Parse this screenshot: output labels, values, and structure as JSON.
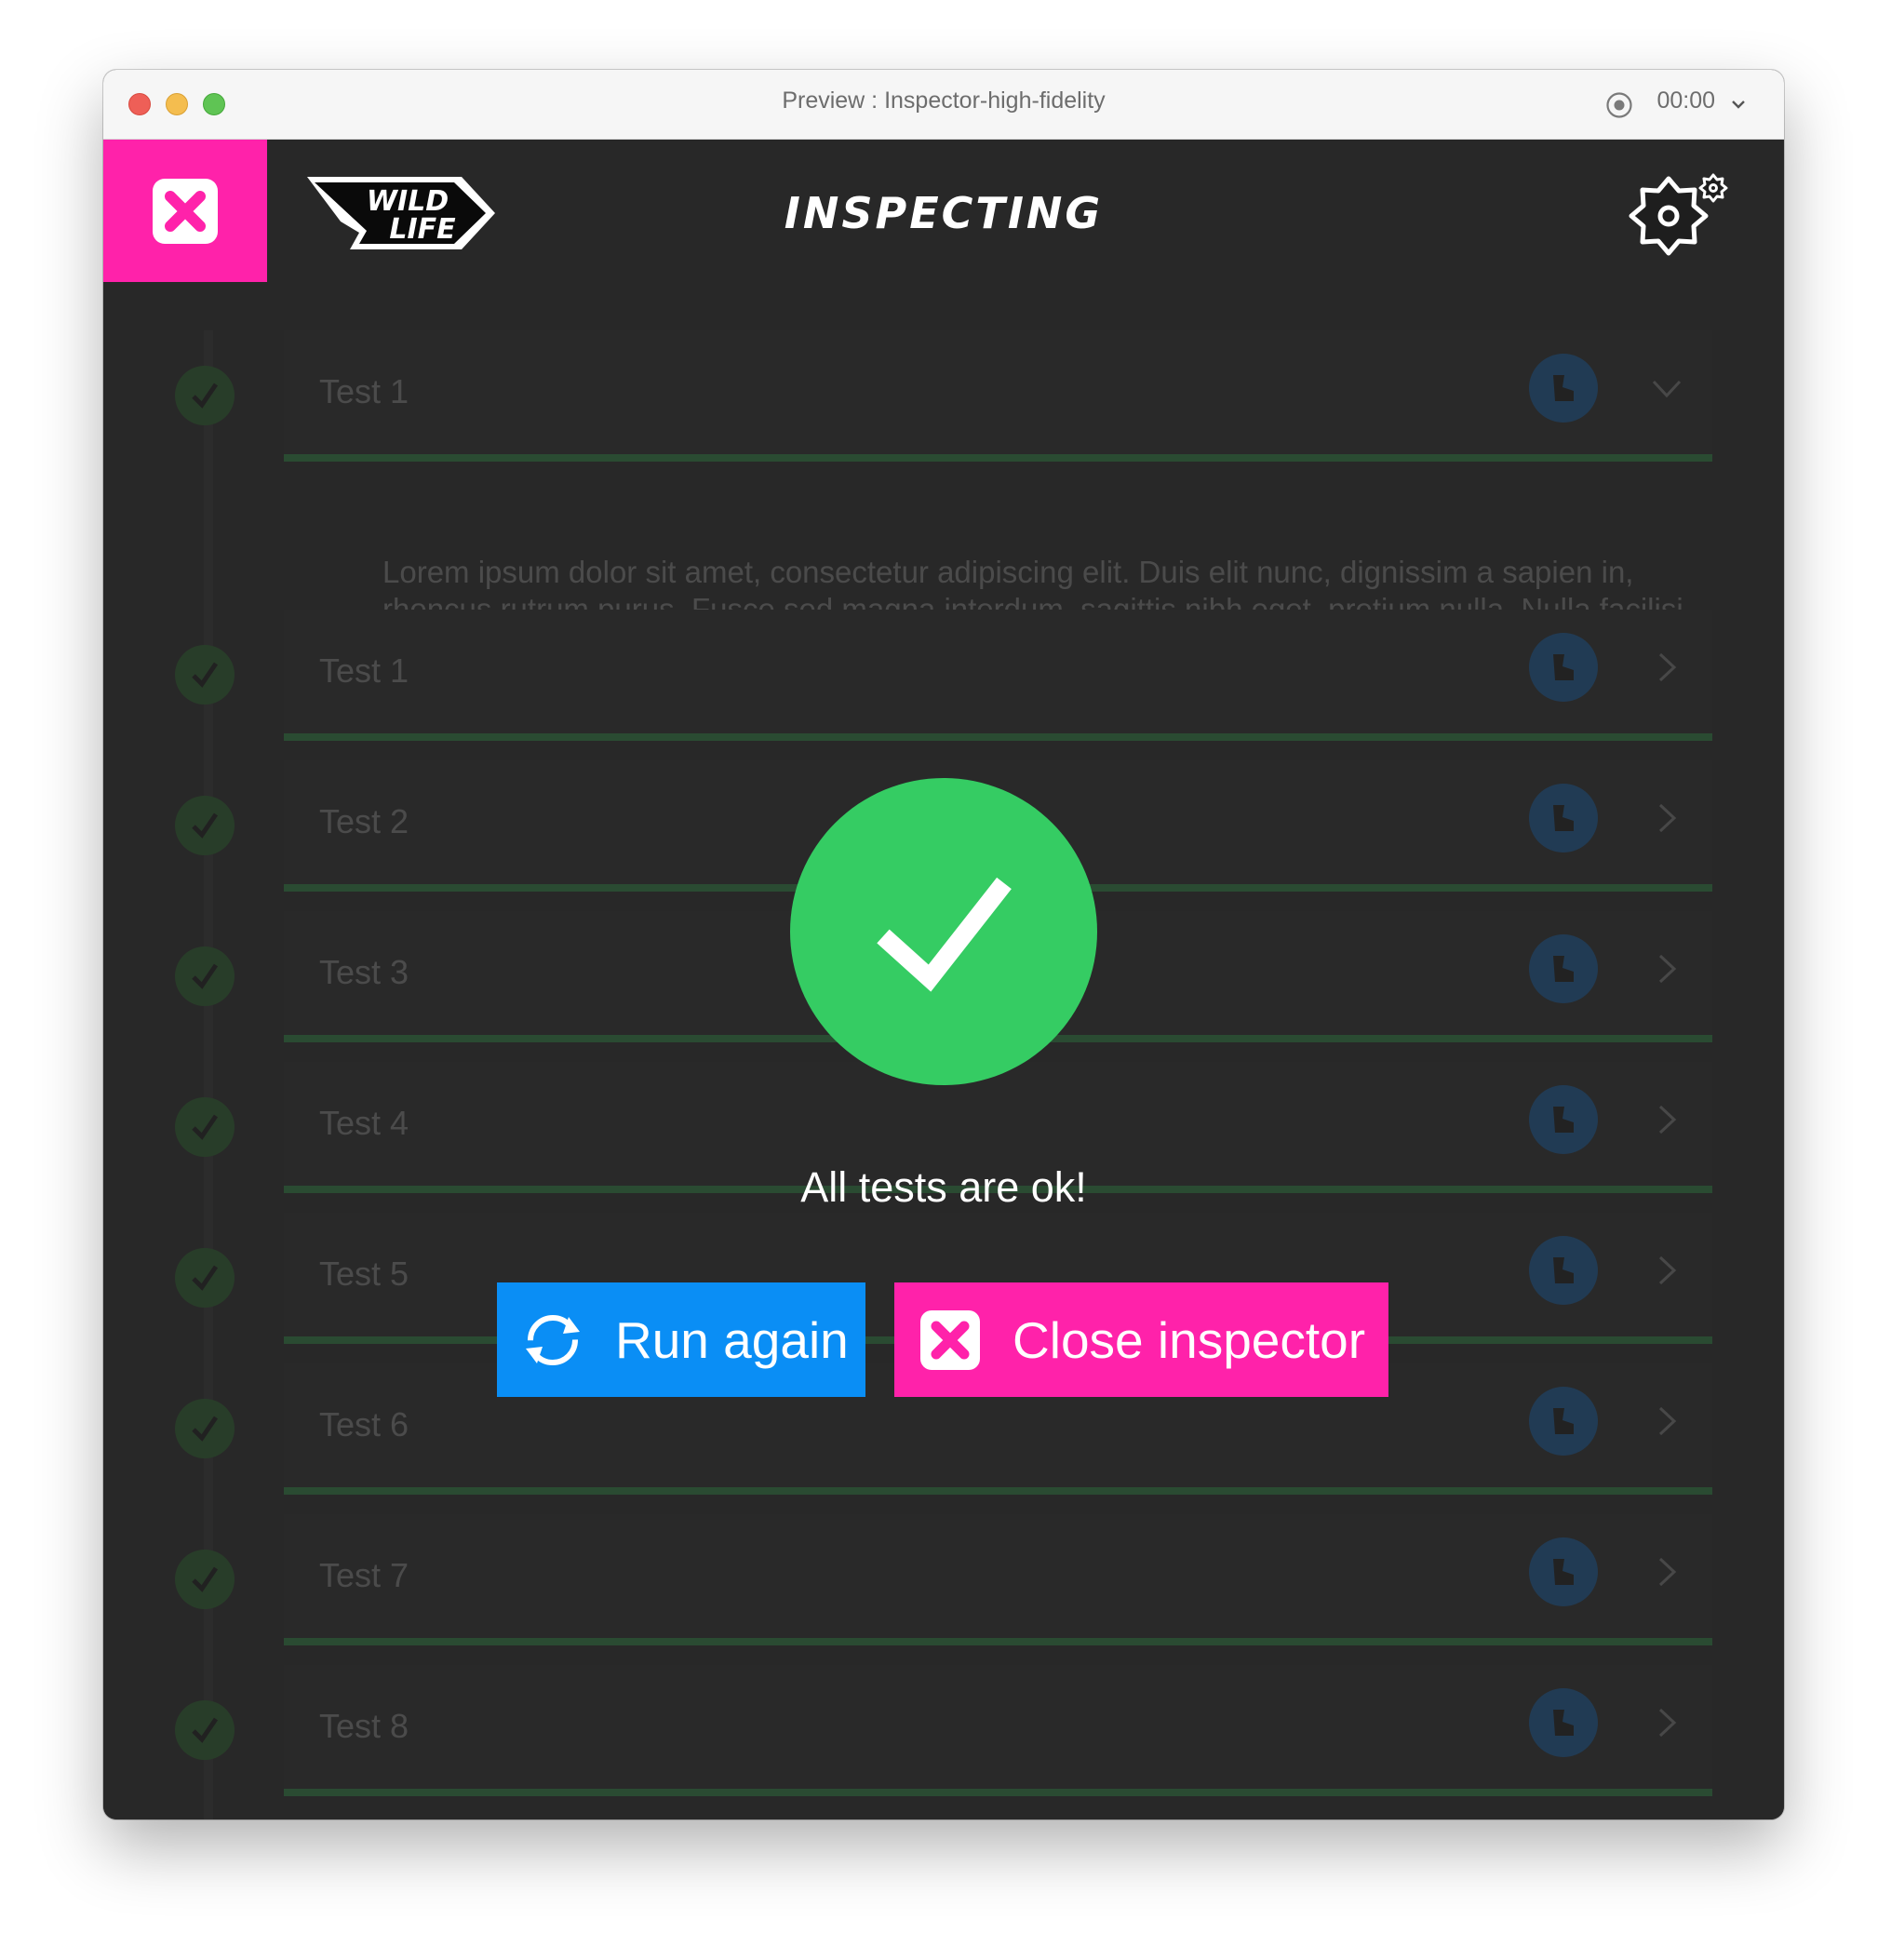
{
  "window": {
    "title": "Preview : Inspector-high-fidelity",
    "recording_time": "00:00"
  },
  "header": {
    "title": "INSPECTING",
    "logo_text": [
      "WILD",
      "LIFE"
    ]
  },
  "tests": [
    {
      "label": "Test 1",
      "status": "passed",
      "expanded": true,
      "description": "Lorem ipsum dolor sit amet, consectetur adipiscing elit. Duis elit nunc, dignissim a sapien in, rhoncus rutrum purus. Fusce sed magna interdum, sagittis nibh eget, pretium nulla. Nulla facilisi. Nunc sed ex sit amet purus sodales dignissim."
    },
    {
      "label": "Test 1",
      "status": "passed",
      "expanded": false
    },
    {
      "label": "Test 2",
      "status": "passed",
      "expanded": false
    },
    {
      "label": "Test 3",
      "status": "passed",
      "expanded": false
    },
    {
      "label": "Test 4",
      "status": "passed",
      "expanded": false
    },
    {
      "label": "Test 5",
      "status": "passed",
      "expanded": false
    },
    {
      "label": "Test 6",
      "status": "passed",
      "expanded": false
    },
    {
      "label": "Test 7",
      "status": "passed",
      "expanded": false
    },
    {
      "label": "Test 8",
      "status": "passed",
      "expanded": false
    }
  ],
  "result": {
    "message": "All tests are ok!",
    "run_again_label": "Run again",
    "close_label": "Close inspector"
  },
  "icons": {
    "close": "close-x-icon",
    "settings": "gear-icon",
    "success": "checkmark-icon",
    "refresh": "refresh-icon",
    "test_status": "check-icon",
    "badge": "shoe-icon",
    "record": "record-icon"
  },
  "colors": {
    "background": "#282828",
    "accent_pink": "#ff22aa",
    "accent_blue": "#0a8ef5",
    "success_green": "#35cc63",
    "row_divider": "#34c759"
  }
}
